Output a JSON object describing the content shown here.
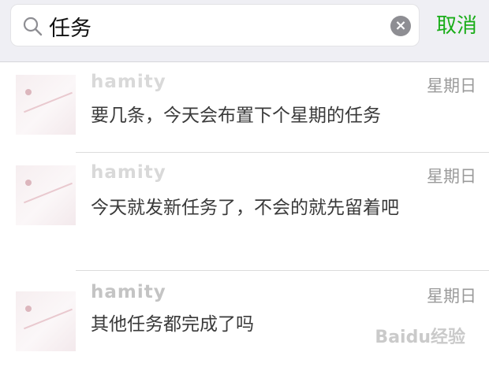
{
  "search": {
    "query": "任务",
    "cancel_label": "取消"
  },
  "results": [
    {
      "name": "hamity",
      "date": "星期日",
      "message": "要几条，今天会布置下个星期的任务"
    },
    {
      "name": "hamity",
      "date": "星期日",
      "message": "今天就发新任务了，不会的就先留着吧"
    },
    {
      "name": "hamity",
      "date": "星期日",
      "message": "其他任务都完成了吗"
    }
  ],
  "watermark": "Baidu经验"
}
